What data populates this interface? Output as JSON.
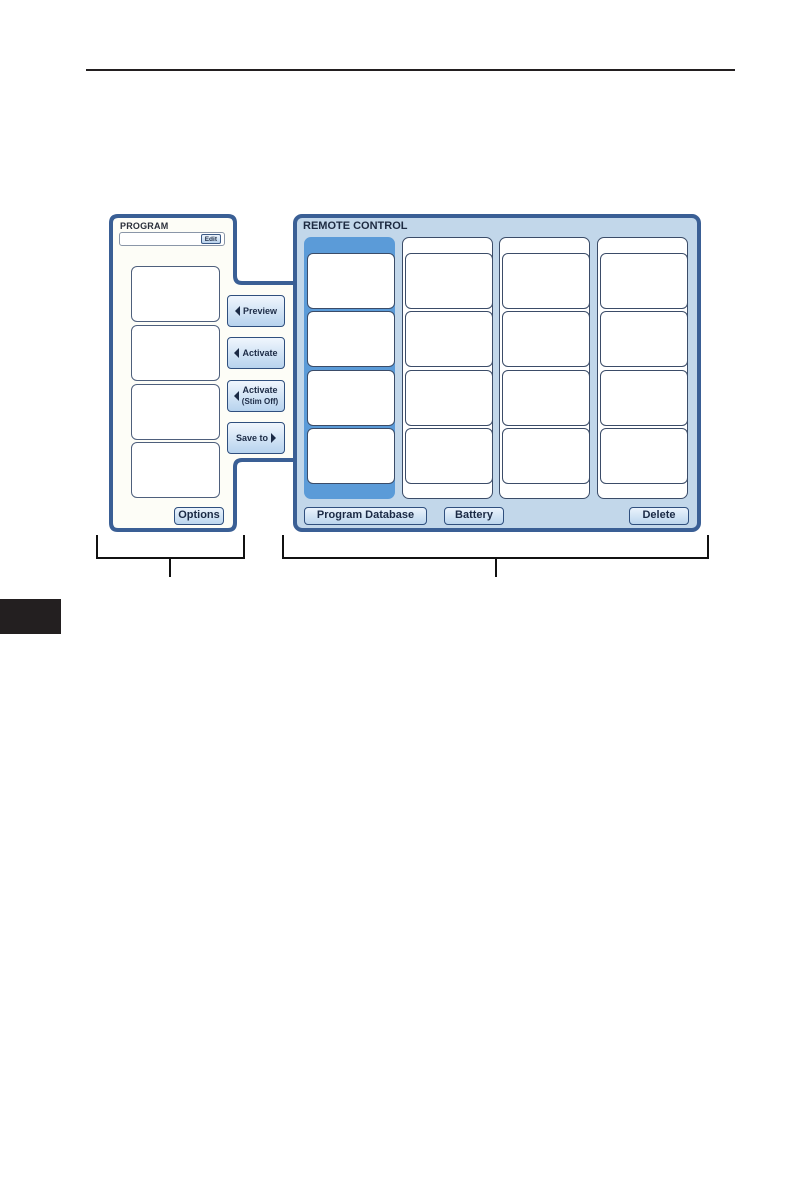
{
  "program_panel": {
    "title": "PROGRAM",
    "name_field_value": "",
    "edit_label": "Edit",
    "slots": [
      "",
      "",
      "",
      ""
    ],
    "options_label": "Options"
  },
  "actions": {
    "preview_label": "Preview",
    "activate_label": "Activate",
    "activate_stim_off_label": "Activate",
    "activate_stim_off_sub": "(Stim Off)",
    "save_to_label": "Save to"
  },
  "remote_panel": {
    "title": "REMOTE CONTROL",
    "active_column": 0,
    "columns": [
      {
        "slots": [
          "",
          "",
          "",
          ""
        ]
      },
      {
        "slots": [
          "",
          "",
          "",
          ""
        ]
      },
      {
        "slots": [
          "",
          "",
          "",
          ""
        ]
      },
      {
        "slots": [
          "",
          "",
          "",
          ""
        ]
      }
    ],
    "program_database_label": "Program Database",
    "battery_label": "Battery",
    "delete_label": "Delete"
  },
  "colors": {
    "panel_border": "#3a5f95",
    "panel_fill": "#c2d7ea",
    "active_column": "#5b9bd8",
    "left_panel_fill": "#fdfdf7"
  }
}
